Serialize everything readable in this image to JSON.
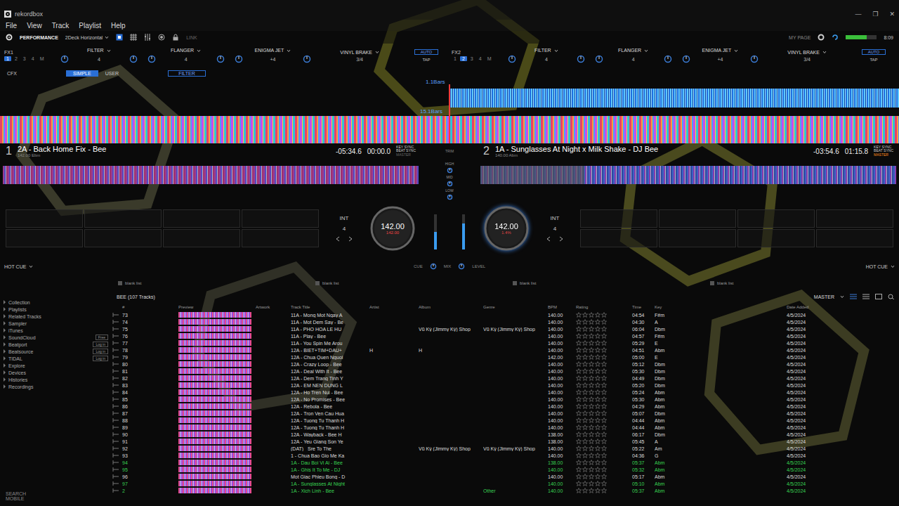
{
  "window": {
    "title": "rekordbox",
    "controls": [
      "—",
      "❐",
      "✕"
    ]
  },
  "menu": [
    "File",
    "View",
    "Track",
    "Playlist",
    "Help"
  ],
  "header": {
    "mode": "PERFORMANCE",
    "layout": "2Deck Horizontal",
    "link": "LINK",
    "mypage": "MY PAGE",
    "clock": "8:09"
  },
  "fx": [
    {
      "label": "FX1",
      "channels": [
        {
          "label": "1",
          "selected": true
        },
        {
          "label": "2",
          "selected": false
        },
        {
          "label": "3",
          "selected": false
        },
        {
          "label": "4",
          "selected": false
        },
        {
          "label": "M",
          "selected": false
        }
      ],
      "effects": [
        {
          "name": "FILTER",
          "beat": "4"
        },
        {
          "name": "FLANGER",
          "beat": "4"
        },
        {
          "name": "ENIGMA JET",
          "beat": "+4"
        }
      ],
      "vinyl": "VINYL BRAKE",
      "fraction": "3/4",
      "auto": "AUTO",
      "tap": "TAP"
    },
    {
      "label": "FX2",
      "channels": [
        {
          "label": "1",
          "selected": false
        },
        {
          "label": "2",
          "selected": true
        },
        {
          "label": "3",
          "selected": false
        },
        {
          "label": "4",
          "selected": false
        },
        {
          "label": "M",
          "selected": false
        }
      ],
      "effects": [
        {
          "name": "FILTER",
          "beat": "4"
        },
        {
          "name": "FLANGER",
          "beat": "4"
        },
        {
          "name": "ENIGMA JET",
          "beat": "+4"
        }
      ],
      "vinyl": "VINYL BRAKE",
      "fraction": "3/4",
      "auto": "AUTO",
      "tap": "TAP"
    }
  ],
  "cfx": {
    "label": "CFX",
    "modes": [
      {
        "label": "SIMPLE",
        "selected": true
      },
      {
        "label": "USER",
        "selected": false
      }
    ],
    "effect": "FILTER"
  },
  "waveform": {
    "marker_top": "1.1Bars",
    "marker_bottom": "15.1Bars"
  },
  "decks": [
    {
      "number": "1",
      "title": "2A - Back Home Fix - Bee",
      "sub": "142.00 Ebm",
      "remain": "-05:34.6",
      "elapsed": "00:00.0",
      "key_sync": "KEY SYNC",
      "beat_sync": "BEAT SYNC",
      "master": "MASTER",
      "bpm": "142.00",
      "pitch": "142.00",
      "quantize": "4",
      "int": "INT",
      "hot_cue": "HOT CUE",
      "progress": 0.0,
      "playing": false,
      "is_master": false
    },
    {
      "number": "2",
      "title": "1A - Sunglasses At Night x Milk Shake - DJ Bee",
      "sub": "140.00 Abm",
      "remain": "-03:54.6",
      "elapsed": "01:15.8",
      "key_sync": "KEY SYNC",
      "beat_sync": "BEAT SYNC",
      "master": "MASTER",
      "bpm": "142.00",
      "pitch": "1.4%",
      "quantize": "4",
      "int": "INT",
      "hot_cue": "HOT CUE",
      "progress": 0.25,
      "playing": true,
      "is_master": true
    }
  ],
  "mixer": {
    "trim": "TRIM",
    "eq": [
      "HIGH",
      "MID",
      "LOW"
    ],
    "cue": "CUE",
    "mix": "MIX",
    "level": "LEVEL",
    "fader_levels": [
      0.5,
      0.75
    ]
  },
  "sidebar": {
    "items": [
      {
        "label": "Collection",
        "login": ""
      },
      {
        "label": "Playlists",
        "login": ""
      },
      {
        "label": "Related Tracks",
        "login": ""
      },
      {
        "label": "Sampler",
        "login": ""
      },
      {
        "label": "iTunes",
        "login": ""
      },
      {
        "label": "SoundCloud",
        "login": "Free"
      },
      {
        "label": "Beatport",
        "login": "Log in"
      },
      {
        "label": "Beatsource",
        "login": "Log in"
      },
      {
        "label": "TIDAL",
        "login": "Log in"
      },
      {
        "label": "Explore",
        "login": ""
      },
      {
        "label": "Devices",
        "login": ""
      },
      {
        "label": "Histories",
        "login": ""
      },
      {
        "label": "Recordings",
        "login": ""
      }
    ],
    "search_mobile": "SEARCH MOBILE"
  },
  "browser": {
    "panels": [
      "blank list",
      "blank list",
      "blank list",
      "blank list"
    ],
    "playlist": "BEE (107 Tracks)",
    "sort": "MASTER",
    "columns": [
      "#",
      "Preview",
      "Artwork",
      "Track Title",
      "Artist",
      "Album",
      "Genre",
      "BPM",
      "Rating",
      "Time",
      "Key",
      "Date Added"
    ],
    "rows": [
      {
        "no": "73",
        "title": "11A - Mong Mot Ngay A",
        "artist": "",
        "album": "",
        "genre": "",
        "bpm": "140.00",
        "stars": 0,
        "time": "04:54",
        "key": "F#m",
        "date": "4/5/2024",
        "played": false
      },
      {
        "no": "74",
        "title": "11A - Mot Dem Say - Be",
        "artist": "",
        "album": "",
        "genre": "",
        "bpm": "140.00",
        "stars": 0,
        "time": "04:30",
        "key": "A",
        "date": "4/5/2024",
        "played": false
      },
      {
        "no": "75",
        "title": "11A - PHO HOA LE HU",
        "artist": "",
        "album": "Vũ Kỳ (Jimmy Kỳ) Shop",
        "genre": "Vũ Kỳ (Jimmy Kỳ) Shop",
        "bpm": "140.00",
        "stars": 0,
        "time": "06:04",
        "key": "Dbm",
        "date": "4/5/2024",
        "played": false
      },
      {
        "no": "76",
        "title": "11A - Play - Bee",
        "artist": "",
        "album": "",
        "genre": "",
        "bpm": "140.00",
        "stars": 0,
        "time": "04:57",
        "key": "F#m",
        "date": "4/5/2024",
        "played": false
      },
      {
        "no": "77",
        "title": "11A - You Spin Me Arou",
        "artist": "",
        "album": "",
        "genre": "",
        "bpm": "140.00",
        "stars": 0,
        "time": "05:29",
        "key": "E",
        "date": "4/5/2024",
        "played": false
      },
      {
        "no": "78",
        "title": "12A - BIET+TIM+DAU+",
        "artist": "H",
        "album": "H",
        "genre": "",
        "bpm": "140.00",
        "stars": 0,
        "time": "04:51",
        "key": "Abm",
        "date": "4/5/2024",
        "played": false
      },
      {
        "no": "79",
        "title": "12A - Chua Quen Nguoi",
        "artist": "",
        "album": "",
        "genre": "",
        "bpm": "142.00",
        "stars": 0,
        "time": "05:00",
        "key": "E",
        "date": "4/5/2024",
        "played": false
      },
      {
        "no": "80",
        "title": "12A - Crazy Loop - Bee",
        "artist": "",
        "album": "",
        "genre": "",
        "bpm": "140.00",
        "stars": 0,
        "time": "05:12",
        "key": "Dbm",
        "date": "4/5/2024",
        "played": false
      },
      {
        "no": "81",
        "title": "12A - Deal With It - Bee",
        "artist": "",
        "album": "",
        "genre": "",
        "bpm": "140.00",
        "stars": 0,
        "time": "05:30",
        "key": "Dbm",
        "date": "4/5/2024",
        "played": false
      },
      {
        "no": "82",
        "title": "12A - Dem Trang Tinh Y",
        "artist": "",
        "album": "",
        "genre": "",
        "bpm": "140.00",
        "stars": 0,
        "time": "04:49",
        "key": "Dbm",
        "date": "4/5/2024",
        "played": false
      },
      {
        "no": "83",
        "title": "12A - EM NEN DUNG L",
        "artist": "",
        "album": "",
        "genre": "",
        "bpm": "140.00",
        "stars": 0,
        "time": "05:20",
        "key": "Dbm",
        "date": "4/5/2024",
        "played": false
      },
      {
        "no": "84",
        "title": "12A - Ho Tren Nui - Bee",
        "artist": "",
        "album": "",
        "genre": "",
        "bpm": "140.00",
        "stars": 0,
        "time": "05:24",
        "key": "Abm",
        "date": "4/5/2024",
        "played": false
      },
      {
        "no": "85",
        "title": "12A - No Promises - Bee",
        "artist": "",
        "album": "",
        "genre": "",
        "bpm": "140.00",
        "stars": 0,
        "time": "05:30",
        "key": "Abm",
        "date": "4/5/2024",
        "played": false
      },
      {
        "no": "86",
        "title": "12A - Rebola - Bee",
        "artist": "",
        "album": "",
        "genre": "",
        "bpm": "140.00",
        "stars": 0,
        "time": "04:29",
        "key": "Abm",
        "date": "4/5/2024",
        "played": false
      },
      {
        "no": "87",
        "title": "12A - Tron Ven Cau Hua",
        "artist": "",
        "album": "",
        "genre": "",
        "bpm": "140.00",
        "stars": 0,
        "time": "05:07",
        "key": "Dbm",
        "date": "4/5/2024",
        "played": false
      },
      {
        "no": "88",
        "title": "12A - Tuong Tu Thanh H",
        "artist": "",
        "album": "",
        "genre": "",
        "bpm": "140.00",
        "stars": 0,
        "time": "04:44",
        "key": "Abm",
        "date": "4/5/2024",
        "played": false
      },
      {
        "no": "89",
        "title": "12A - Tuong Tu Thanh H",
        "artist": "",
        "album": "",
        "genre": "",
        "bpm": "140.00",
        "stars": 0,
        "time": "04:44",
        "key": "Abm",
        "date": "4/5/2024",
        "played": false
      },
      {
        "no": "90",
        "title": "12A - Wayback - Bee H",
        "artist": "",
        "album": "",
        "genre": "",
        "bpm": "138.00",
        "stars": 0,
        "time": "06:17",
        "key": "Dbm",
        "date": "4/5/2024",
        "played": false
      },
      {
        "no": "91",
        "title": "12A - Yeu Giang Son Ye",
        "artist": "",
        "album": "",
        "genre": "",
        "bpm": "138.00",
        "stars": 0,
        "time": "05:45",
        "key": "A",
        "date": "4/5/2024",
        "played": false
      },
      {
        "no": "92",
        "title": "(DAT)_ Sre To The",
        "artist": "",
        "album": "Vũ Kỳ (Jimmy Kỳ) Shop",
        "genre": "Vũ Kỳ (Jimmy Kỳ) Shop",
        "bpm": "140.00",
        "stars": 0,
        "time": "05:22",
        "key": "Am",
        "date": "4/5/2024",
        "played": false
      },
      {
        "no": "93",
        "title": "1 - Chua Bao Gio Me Ka",
        "artist": "",
        "album": "",
        "genre": "",
        "bpm": "140.00",
        "stars": 0,
        "time": "04:36",
        "key": "G",
        "date": "4/5/2024",
        "played": false
      },
      {
        "no": "94",
        "title": "1A - Dau Boi Vi Ai - Bee",
        "artist": "",
        "album": "",
        "genre": "",
        "bpm": "138.00",
        "stars": 0,
        "time": "05:37",
        "key": "Abm",
        "date": "4/5/2024",
        "played": true
      },
      {
        "no": "95",
        "title": "1A - Ghis It To Me - DJ",
        "artist": "",
        "album": "",
        "genre": "",
        "bpm": "140.00",
        "stars": 0,
        "time": "05:32",
        "key": "Abm",
        "date": "4/5/2024",
        "played": true
      },
      {
        "no": "96",
        "title": "Mot Giac Phieu Bong - D",
        "artist": "",
        "album": "",
        "genre": "",
        "bpm": "140.00",
        "stars": 0,
        "time": "05:17",
        "key": "Abm",
        "date": "4/5/2024",
        "played": false
      },
      {
        "no": "97",
        "title": "1A - Sunglasses At Night",
        "artist": "",
        "album": "",
        "genre": "",
        "bpm": "140.00",
        "stars": 0,
        "time": "05:10",
        "key": "Abm",
        "date": "4/5/2024",
        "played": true
      },
      {
        "no": "2",
        "title": "1A - Xich Linh - Bee",
        "artist": "",
        "album": "",
        "genre": "Other",
        "bpm": "140.00",
        "stars": 0,
        "time": "05:37",
        "key": "Abm",
        "date": "4/5/2024",
        "played": true
      }
    ]
  }
}
